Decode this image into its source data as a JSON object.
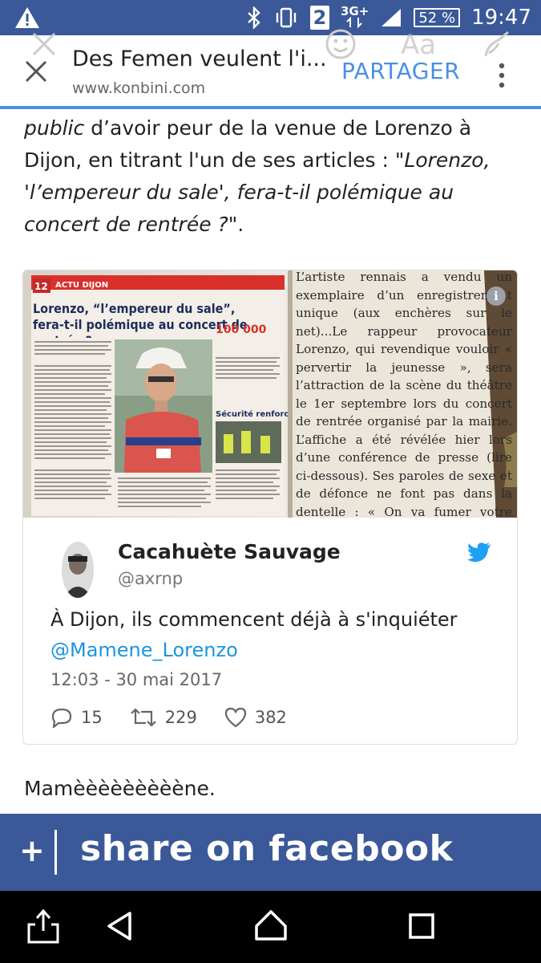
{
  "status_bar": {
    "sim_slot": "2",
    "network": "3G+",
    "battery": "52 %",
    "time": "19:47",
    "icons": [
      "warning-icon",
      "bluetooth-icon",
      "vibrate-icon",
      "signal-icon"
    ]
  },
  "browser": {
    "title": "Des Femen veulent l'i...",
    "url": "www.konbini.com",
    "share_label": "PARTAGER",
    "overlay_text": "Aa"
  },
  "article": {
    "paragraph_parts": [
      "public",
      " d’avoir peur de la venue de Lorenzo à Dijon, en titrant l'un de ses articles : ",
      "\"Lorenzo, 'l’empereur du sale', fera-t-il polémique au concert de rentrée ?\"",
      "."
    ],
    "closing": "Mamèèèèèèèèène."
  },
  "newspaper": {
    "page_number": "12",
    "section": "ACTU DIJON",
    "headline": "Lorenzo, “l’empereur du sale”, fera-t-il polémique au concert de rentrée ?",
    "stat": "100 000",
    "sub_heading": "Sécurité renforcée",
    "right_column": "L’artiste rennais a vendu un exemplaire d’un enregistrement unique (aux enchères sur le net)...Le rappeur provocateur Lorenzo, qui revendique vouloir « pervertir la jeunesse », sera l’attraction de la scène du théâtre le 1er septembre lors du concert de rentrée organisé par la mairie. L’affiche a été révélée hier lors d’une conférence de presse (lire ci-dessous). Ses paroles de sexe et de défonce ne font pas dans la dentelle : « On va fumer votre herbe... Briquet devant mon cul, j’crache le feu comme un dragon, on a pimpé ta meuf, sous ses fesses y a des néons... J’ai niqué la sœur de la mère de ta cousine... » (extrait gen"
  },
  "tweet": {
    "display_name": "Cacahuète Sauvage",
    "handle": "@axrnp",
    "text": "À Dijon, ils commencent déjà à s'inquiéter",
    "mention": "@Mamene_Lorenzo",
    "timestamp": "12:03 - 30 mai 2017",
    "replies": "15",
    "retweets": "229",
    "likes": "382"
  },
  "share_bar": {
    "plus": "+",
    "label": "share on facebook"
  },
  "nav": {
    "buttons": [
      "share-icon",
      "back-icon",
      "home-icon",
      "recents-icon"
    ]
  },
  "colors": {
    "facebook_blue": "#3b5998",
    "accent_blue": "#4a90e2",
    "twitter_blue": "#1da1f2"
  }
}
